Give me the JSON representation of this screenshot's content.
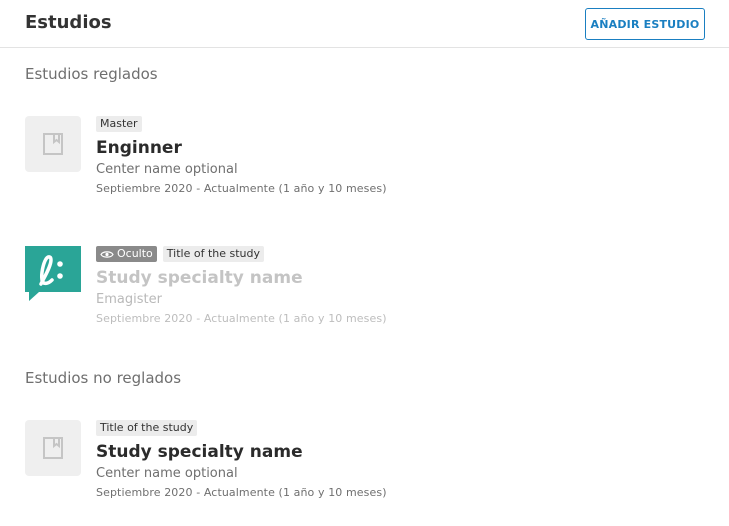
{
  "header": {
    "title": "Estudios",
    "add_button_label": "AÑADIR ESTUDIO"
  },
  "sections": {
    "regulated": {
      "title": "Estudios reglados",
      "items": [
        {
          "tags": [
            "Master"
          ],
          "name": "Enginner",
          "center": "Center name optional",
          "dates": "Septiembre 2020 - Actualmente (1 año y 10 meses)",
          "logo_icon": "book-icon"
        },
        {
          "hidden_label": "Oculto",
          "tags": [
            "Title of the study"
          ],
          "name": "Study specialty name",
          "center": "Emagister",
          "dates": "Septiembre 2020 - Actualmente (1 año y 10 meses)",
          "logo_icon": "emagister-logo",
          "brand_color": "#2aa597"
        }
      ]
    },
    "non_regulated": {
      "title": "Estudios no reglados",
      "items": [
        {
          "tags": [
            "Title of the study"
          ],
          "name": "Study specialty name",
          "center": "Center name optional",
          "dates": "Septiembre 2020 - Actualmente (1 año y 10 meses)",
          "logo_icon": "book-icon"
        }
      ]
    }
  },
  "colors": {
    "accent": "#1a7fc1",
    "hidden_badge": "#8a8a8a"
  }
}
